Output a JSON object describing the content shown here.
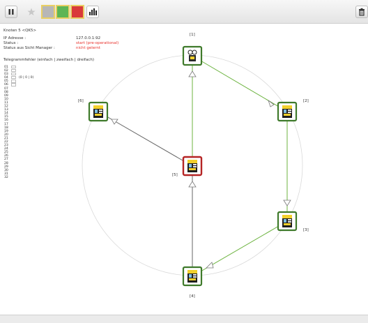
{
  "toolbar": {
    "pause_icon": "pause-icon",
    "star_icon": "star-icon",
    "swatch_gray": "#b7b7b7",
    "swatch_green": "#5db555",
    "swatch_red": "#d93a3a",
    "chart_icon": "bar-chart-icon",
    "trash_icon": "trash-icon"
  },
  "info": {
    "node_title": "Knoten 5 <QK5>",
    "ip_label": "IP Adresse :",
    "ip_value": "127.0.0.1:92",
    "status_label": "Status :",
    "status_value": "start (pre-operational)",
    "manager_label": "Status aus Sicht Manager :",
    "manager_value": "nicht gelernt",
    "telegram_title": "Telegrammfehler (einfach | zweifach | dreifach)",
    "telegram_counts": "(0 | 0 | 0)",
    "rows": [
      "01",
      "02",
      "03",
      "04",
      "05",
      "06",
      "07",
      "08",
      "09",
      "10",
      "11",
      "12",
      "13",
      "14",
      "15",
      "16",
      "17",
      "18",
      "19",
      "20",
      "21",
      "22",
      "23",
      "24",
      "25",
      "26",
      "27",
      "28",
      "29",
      "30",
      "31",
      "32"
    ]
  },
  "nodes": {
    "n1": "[1]",
    "n2": "[2]",
    "n3": "[3]",
    "n4": "[4]",
    "n5": "[5]",
    "n6": "[6]"
  },
  "colors": {
    "green_link": "#6cb33f",
    "gray_link": "#666666",
    "selected_border": "#b52424",
    "node_border": "#3f7a2b",
    "circle": "#d9d9d9"
  }
}
